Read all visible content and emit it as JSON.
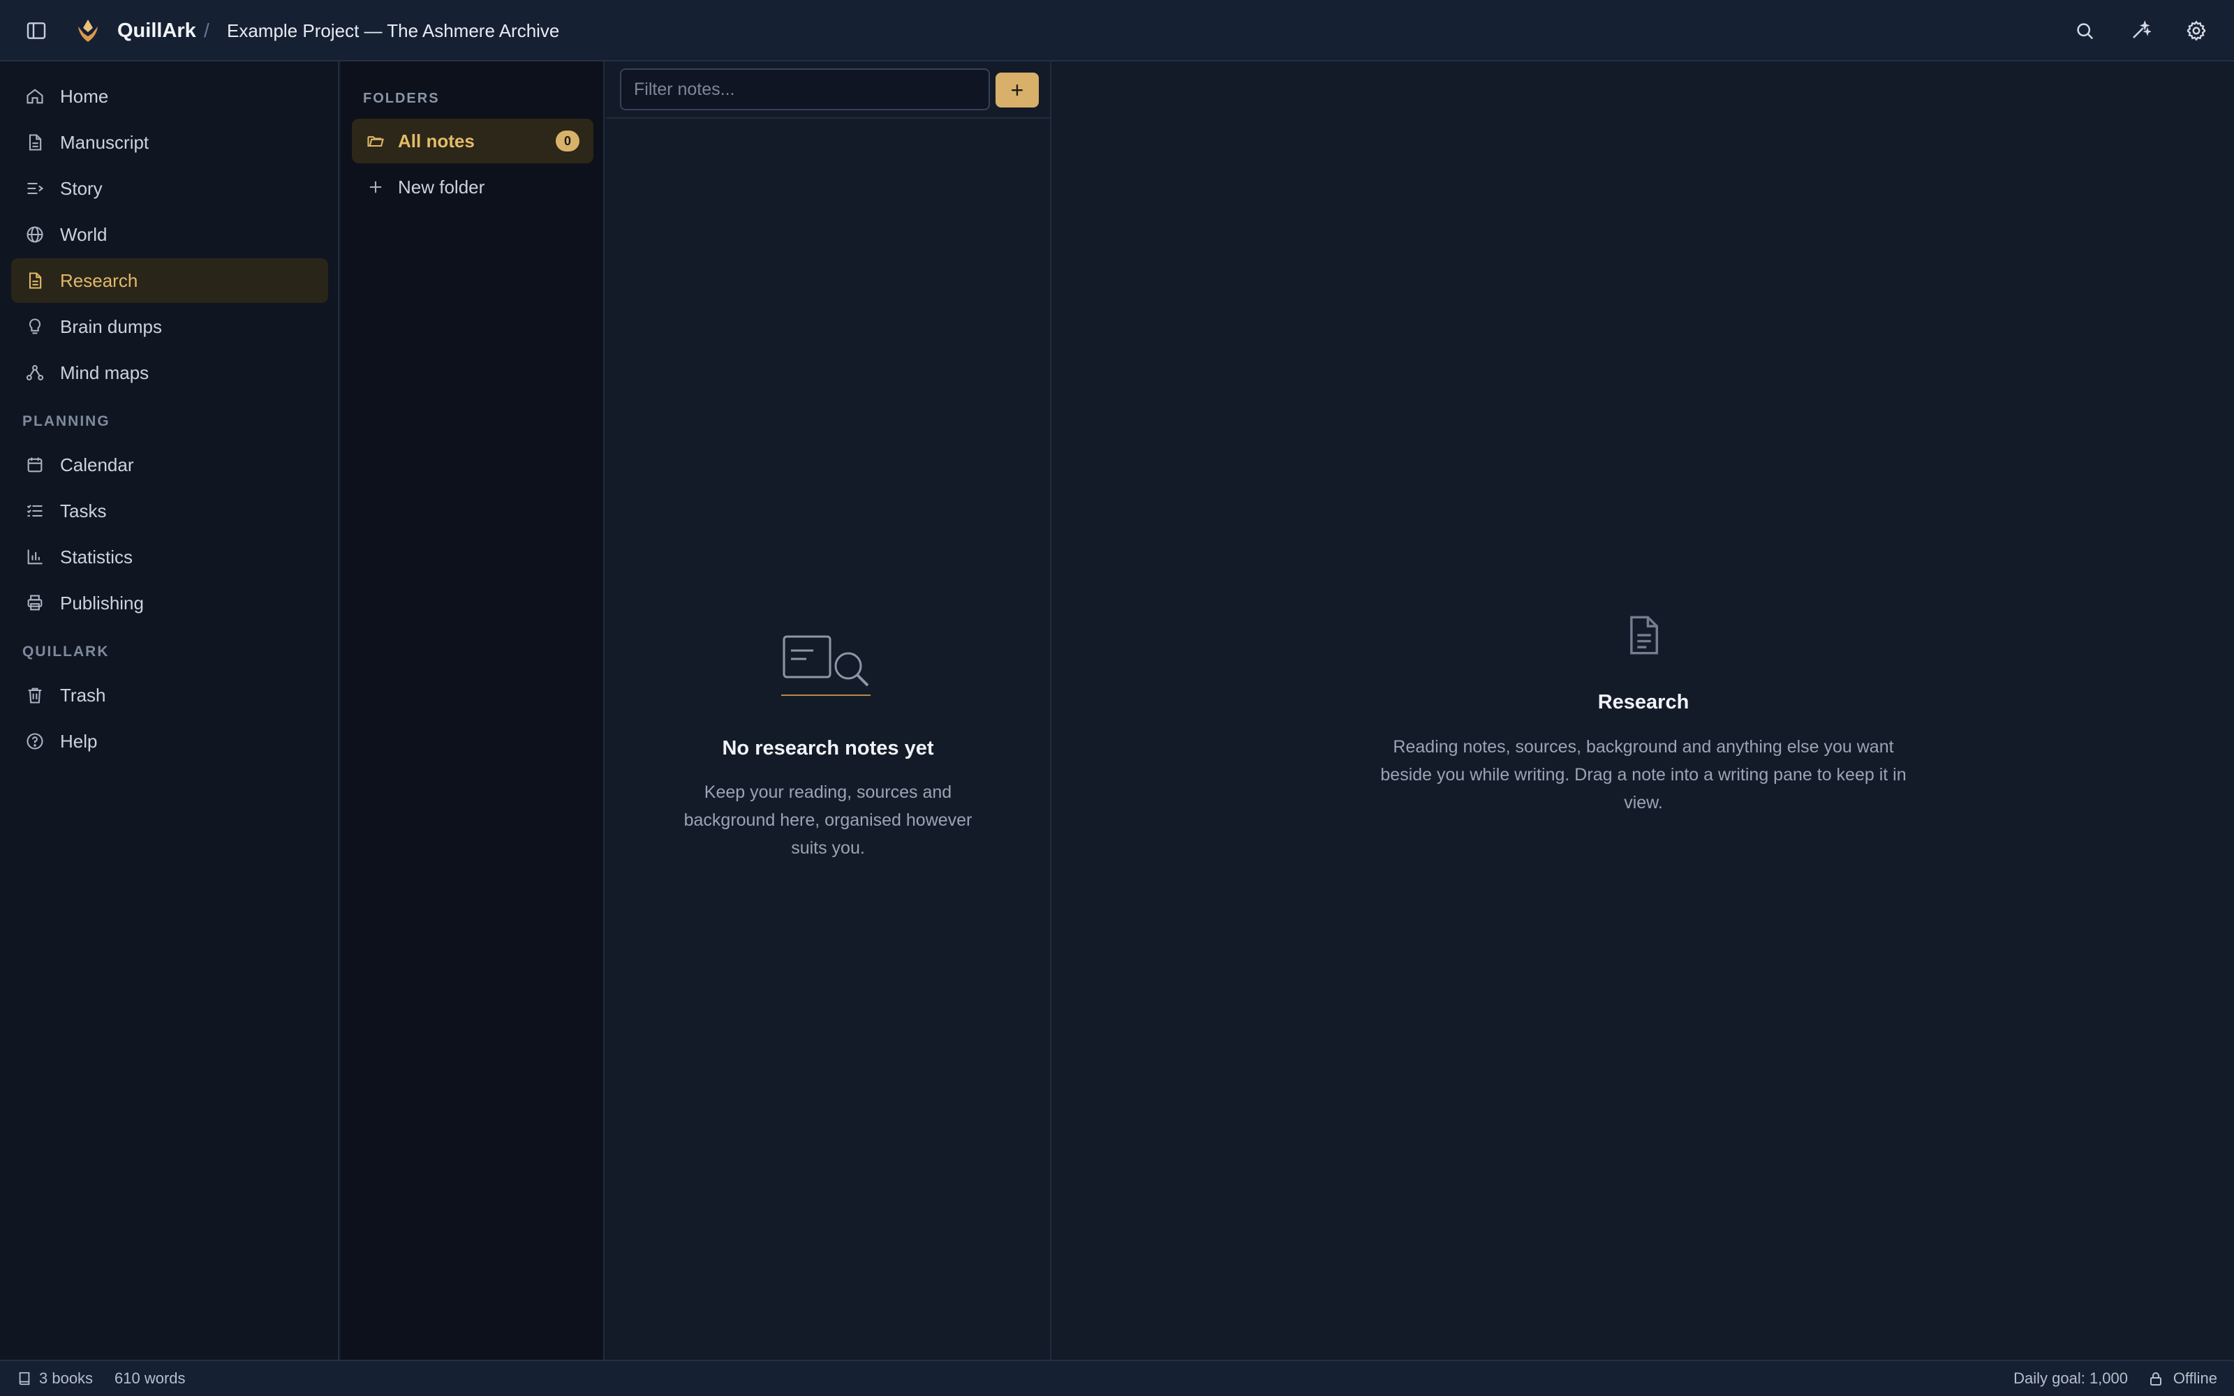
{
  "header": {
    "app_name": "QuillArk",
    "separator": "/",
    "project_title": "Example Project — The Ashmere Archive",
    "icons": [
      "sidebar-toggle-icon",
      "quillark-logo",
      "search-icon",
      "magic-wand-icon",
      "gear-icon"
    ]
  },
  "sidebar": {
    "main_items": [
      {
        "label": "Home",
        "icon": "home-icon"
      },
      {
        "label": "Manuscript",
        "icon": "document-icon"
      },
      {
        "label": "Story",
        "icon": "story-lines-icon"
      },
      {
        "label": "World",
        "icon": "globe-icon"
      },
      {
        "label": "Research",
        "icon": "research-icon",
        "active": true
      },
      {
        "label": "Brain dumps",
        "icon": "lightbulb-icon"
      },
      {
        "label": "Mind maps",
        "icon": "mind-map-icon"
      }
    ],
    "planning_label": "PLANNING",
    "planning_items": [
      {
        "label": "Calendar",
        "icon": "calendar-icon"
      },
      {
        "label": "Tasks",
        "icon": "tasks-icon"
      },
      {
        "label": "Statistics",
        "icon": "chart-icon"
      },
      {
        "label": "Publishing",
        "icon": "printer-icon"
      }
    ],
    "quillark_label": "QUILLARK",
    "quillark_items": [
      {
        "label": "Trash",
        "icon": "trash-icon"
      },
      {
        "label": "Help",
        "icon": "help-icon"
      }
    ]
  },
  "folders": {
    "heading": "FOLDERS",
    "all_notes_label": "All notes",
    "all_notes_count": "0",
    "new_folder_label": "New folder"
  },
  "notes": {
    "filter_placeholder": "Filter notes...",
    "add_label": "+",
    "empty_title": "No research notes yet",
    "empty_desc": "Keep your reading, sources and background here, organised however suits you."
  },
  "detail": {
    "title": "Research",
    "desc": "Reading notes, sources, background and anything else you want beside you while writing. Drag a note into a writing pane to keep it in view."
  },
  "status": {
    "books": "3 books",
    "words": "610 words",
    "daily_goal": "Daily goal: 1,000",
    "offline": "Offline"
  },
  "colors": {
    "accent": "#e0b96a",
    "active_bg": "#2a2519",
    "bg": "#131a27"
  }
}
